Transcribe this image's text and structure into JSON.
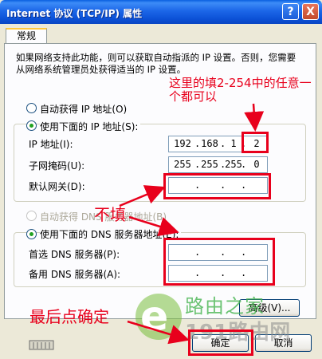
{
  "window": {
    "title": "Internet 协议 (TCP/IP) 属性",
    "help_label": "?",
    "close_label": "X"
  },
  "tab": {
    "label": "常规"
  },
  "description": "如果网络支持此功能，则可以获取自动指派的 IP 设置。否则，您需要从网络系统管理员处获得适当的 IP 设置。",
  "ip_mode": {
    "auto_label": "自动获得 IP 地址(O)",
    "manual_label": "使用下面的 IP 地址(S):",
    "selected": "manual"
  },
  "ip_fields": {
    "ip_label": "IP 地址(I):",
    "ip_value": [
      "192",
      "168",
      "1",
      "2"
    ],
    "mask_label": "子网掩码(U):",
    "mask_value": [
      "255",
      "255",
      "255",
      "0"
    ],
    "gateway_label": "默认网关(D):",
    "gateway_value": [
      "",
      "",
      "",
      ""
    ]
  },
  "dns_mode": {
    "auto_label": "自动获得 DNS 服务器地址(B)",
    "manual_label": "使用下面的 DNS 服务器地址(E):",
    "selected": "manual"
  },
  "dns_fields": {
    "preferred_label": "首选 DNS 服务器(P):",
    "preferred_value": [
      "",
      "",
      "",
      ""
    ],
    "alternate_label": "备用 DNS 服务器(A):",
    "alternate_value": [
      "",
      "",
      "",
      ""
    ]
  },
  "advanced_label": "高级(V)...",
  "footer": {
    "ok_label": "确定",
    "cancel_label": "取消"
  },
  "annotations": {
    "ip_note": "这里的填2-254中的任意一个都可以",
    "no_fill": "不填",
    "final_step": "最后点确定"
  },
  "watermark": {
    "line1": "路由之家",
    "line2": "191路由网"
  },
  "colors": {
    "title_blue": "#0b50d6",
    "annotation_red": "#e8001c",
    "selected_radio": "#21a121",
    "window_bg": "#ece9d8"
  }
}
